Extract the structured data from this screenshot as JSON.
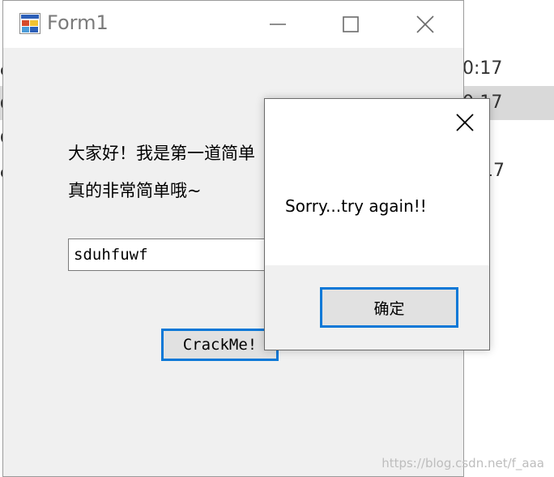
{
  "background": {
    "times": [
      "0:17",
      "0:17",
      "17"
    ],
    "left_chars": [
      "c",
      "C",
      "C",
      "e"
    ]
  },
  "form1": {
    "title": "Form1",
    "greeting_line1": "大家好！我是第一道简单",
    "greeting_line2": "真的非常简单哦~",
    "input_value": "sduhfuwf",
    "crack_button": "CrackMe!"
  },
  "msgbox": {
    "message": "Sorry...try again!!",
    "ok_button": "确定"
  },
  "watermark": "https://blog.csdn.net/f_aaa",
  "colors": {
    "accent": "#0a78d7",
    "window_bg": "#f0f0f0",
    "button_bg": "#e1e1e1"
  }
}
